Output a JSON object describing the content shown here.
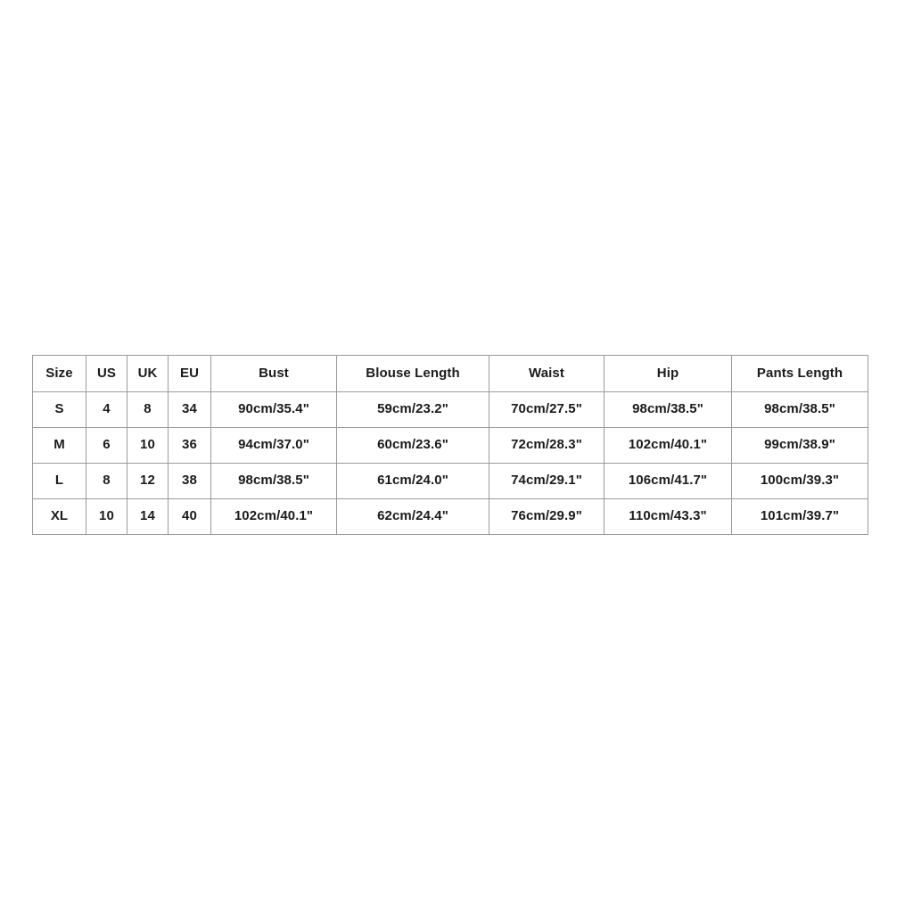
{
  "page": {
    "background_color": "#ffffff",
    "table_border_color": "#9a9a9a",
    "text_color": "#1b1b1b"
  },
  "size_chart": {
    "name": "size-chart-table",
    "columns": [
      "Size",
      "US",
      "UK",
      "EU",
      "Bust",
      "Blouse Length",
      "Waist",
      "Hip",
      "Pants Length"
    ],
    "rows": [
      {
        "size": "S",
        "us": "4",
        "uk": "8",
        "eu": "34",
        "bust": "90cm/35.4\"",
        "blouse_length": "59cm/23.2\"",
        "waist": "70cm/27.5\"",
        "hip": "98cm/38.5\"",
        "pants_length": "98cm/38.5\""
      },
      {
        "size": "M",
        "us": "6",
        "uk": "10",
        "eu": "36",
        "bust": "94cm/37.0\"",
        "blouse_length": "60cm/23.6\"",
        "waist": "72cm/28.3\"",
        "hip": "102cm/40.1\"",
        "pants_length": "99cm/38.9\""
      },
      {
        "size": "L",
        "us": "8",
        "uk": "12",
        "eu": "38",
        "bust": "98cm/38.5\"",
        "blouse_length": "61cm/24.0\"",
        "waist": "74cm/29.1\"",
        "hip": "106cm/41.7\"",
        "pants_length": "100cm/39.3\""
      },
      {
        "size": "XL",
        "us": "10",
        "uk": "14",
        "eu": "40",
        "bust": "102cm/40.1\"",
        "blouse_length": "62cm/24.4\"",
        "waist": "76cm/29.9\"",
        "hip": "110cm/43.3\"",
        "pants_length": "101cm/39.7\""
      }
    ]
  }
}
